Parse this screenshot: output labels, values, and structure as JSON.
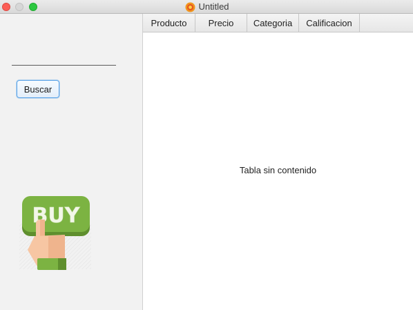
{
  "window": {
    "title": "Untitled",
    "controls": {
      "close": "close-button",
      "minimize": "minimize-button",
      "maximize": "maximize-button"
    }
  },
  "search": {
    "value": "",
    "button_label": "Buscar"
  },
  "promo": {
    "image_text": "BUY",
    "icon": "buy-hand-icon"
  },
  "table": {
    "columns": [
      "Producto",
      "Precio",
      "Categoria",
      "Calificacion"
    ],
    "rows": [],
    "empty_message": "Tabla sin contenido"
  },
  "colors": {
    "close": "#fc5f57",
    "minimize": "#d7d7d7",
    "maximize": "#2cc840",
    "button_focus": "#5aa3e8",
    "buy_green": "#7cb342"
  }
}
